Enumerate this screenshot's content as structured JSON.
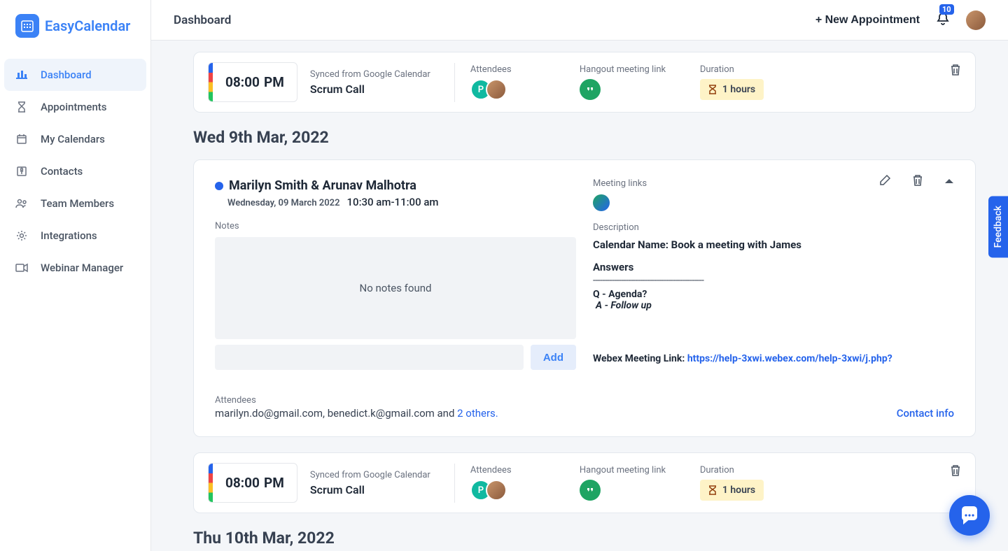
{
  "brand": "EasyCalendar",
  "nav": {
    "items": [
      {
        "label": "Dashboard",
        "icon": "chart"
      },
      {
        "label": "Appointments",
        "icon": "hourglass"
      },
      {
        "label": "My Calendars",
        "icon": "calendar"
      },
      {
        "label": "Contacts",
        "icon": "contacts"
      },
      {
        "label": "Team Members",
        "icon": "team"
      },
      {
        "label": "Integrations",
        "icon": "gear"
      },
      {
        "label": "Webinar Manager",
        "icon": "video"
      }
    ]
  },
  "topbar": {
    "title": "Dashboard",
    "new_btn": "+ New Appointment",
    "notif_count": "10"
  },
  "compact1": {
    "time": "08:00",
    "ampm": "PM",
    "synced_label": "Synced from Google Calendar",
    "title": "Scrum Call",
    "attendees_label": "Attendees",
    "attendee_initial": "P",
    "hangout_label": "Hangout meeting link",
    "duration_label": "Duration",
    "duration_value": "1 hours"
  },
  "date_heading_1": "Wed 9th Mar, 2022",
  "expanded": {
    "title": "Marilyn Smith & Arunav Malhotra",
    "date": "Wednesday, 09 March 2022",
    "time": "10:30 am-11:00 am",
    "notes_label": "Notes",
    "notes_empty": "No notes found",
    "add_btn": "Add",
    "meeting_links_label": "Meeting links",
    "description_label": "Description",
    "calendar_name": "Calendar Name: Book a meeting with James",
    "answers_heading": "Answers",
    "dashes": "-----------------------------------------------",
    "q": "Q - Agenda?",
    "a": "A - Follow up",
    "webex_label": "Webex Meeting Link: ",
    "webex_url": "https://help-3xwi.webex.com/help-3xwi/j.php?",
    "attendees_label": "Attendees",
    "attendees_text_1": "marilyn.do@gmail.com, benedict.k@gmail.com and ",
    "attendees_link": "2 others.",
    "contact_info": "Contact info"
  },
  "compact2": {
    "time": "08:00",
    "ampm": "PM",
    "synced_label": "Synced from Google Calendar",
    "title": "Scrum Call",
    "attendees_label": "Attendees",
    "attendee_initial": "P",
    "hangout_label": "Hangout meeting link",
    "duration_label": "Duration",
    "duration_value": "1 hours"
  },
  "date_heading_2": "Thu 10th Mar, 2022",
  "feedback_label": "Feedback"
}
